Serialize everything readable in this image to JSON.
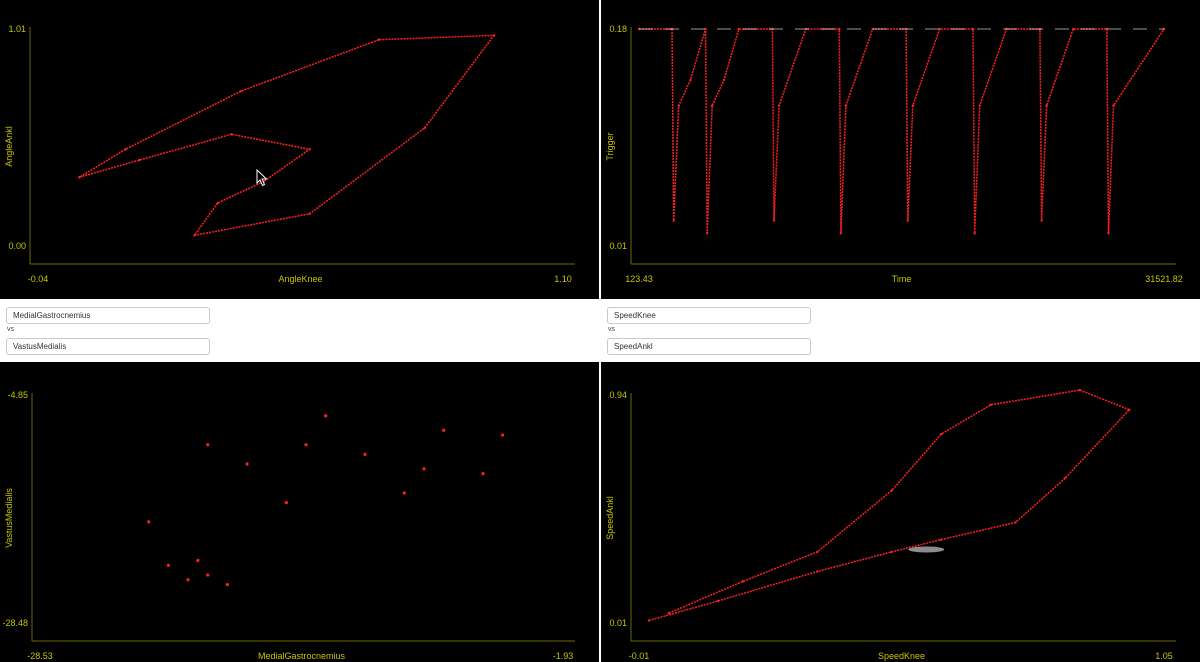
{
  "colors": {
    "background": "#000000",
    "axis": "#c8c400",
    "data": "#ff2020",
    "highlight": "#ffffff"
  },
  "controls": {
    "left": {
      "x_field": "MedialGastrocnemius",
      "vs_label": "vs",
      "y_field": "VastusMedialis"
    },
    "right": {
      "x_field": "SpeedKnee",
      "vs_label": "vs",
      "y_field": "SpeedAnkl"
    }
  },
  "chart_data": [
    {
      "type": "line",
      "xlabel": "AngleKnee",
      "ylabel": "AngleAnkl",
      "xlim": [
        -0.04,
        1.1
      ],
      "ylim": [
        0.0,
        1.01
      ],
      "x_ticks": [
        "-0.04",
        "1.10"
      ],
      "y_ticks": [
        "0.00",
        "1.01"
      ],
      "series": [
        {
          "values": [
            [
              0.05,
              0.32
            ],
            [
              0.18,
              0.4
            ],
            [
              0.38,
              0.52
            ],
            [
              0.55,
              0.45
            ],
            [
              0.45,
              0.3
            ],
            [
              0.35,
              0.2
            ],
            [
              0.3,
              0.05
            ],
            [
              0.55,
              0.15
            ],
            [
              0.8,
              0.55
            ],
            [
              0.95,
              0.98
            ],
            [
              0.7,
              0.96
            ],
            [
              0.4,
              0.72
            ],
            [
              0.15,
              0.45
            ],
            [
              0.05,
              0.32
            ]
          ]
        }
      ]
    },
    {
      "type": "line",
      "xlabel": "Time",
      "ylabel": "Trigger",
      "xlim": [
        123.43,
        31521.82
      ],
      "ylim": [
        0.01,
        0.18
      ],
      "x_ticks": [
        "123.43",
        "31521.82"
      ],
      "y_ticks": [
        "0.01",
        "0.18"
      ],
      "series": [
        {
          "values": [
            [
              123.43,
              0.18
            ],
            [
              2100,
              0.18
            ],
            [
              2200,
              0.03
            ],
            [
              2500,
              0.12
            ],
            [
              3200,
              0.14
            ],
            [
              4100,
              0.18
            ],
            [
              4200,
              0.02
            ],
            [
              4500,
              0.12
            ],
            [
              5200,
              0.14
            ],
            [
              6100,
              0.18
            ],
            [
              8100,
              0.18
            ],
            [
              8200,
              0.03
            ],
            [
              8500,
              0.12
            ],
            [
              10100,
              0.18
            ],
            [
              12100,
              0.18
            ],
            [
              12200,
              0.02
            ],
            [
              12500,
              0.12
            ],
            [
              14100,
              0.18
            ],
            [
              16100,
              0.18
            ],
            [
              16200,
              0.03
            ],
            [
              16500,
              0.12
            ],
            [
              18100,
              0.18
            ],
            [
              20100,
              0.18
            ],
            [
              20200,
              0.02
            ],
            [
              20500,
              0.12
            ],
            [
              22100,
              0.18
            ],
            [
              24100,
              0.18
            ],
            [
              24200,
              0.03
            ],
            [
              24500,
              0.12
            ],
            [
              26100,
              0.18
            ],
            [
              28100,
              0.18
            ],
            [
              28200,
              0.02
            ],
            [
              28500,
              0.12
            ],
            [
              31521.82,
              0.18
            ]
          ]
        }
      ]
    },
    {
      "type": "scatter",
      "xlabel": "MedialGastrocnemius",
      "ylabel": "VastusMedialis",
      "xlim": [
        -28.53,
        -1.93
      ],
      "ylim": [
        -28.48,
        -4.85
      ],
      "x_ticks": [
        "-28.53",
        "-1.93"
      ],
      "y_ticks": [
        "-28.48",
        "-4.85"
      ],
      "series": [
        {
          "values": [
            [
              -21.0,
              -24.0
            ],
            [
              -20.0,
              -23.5
            ],
            [
              -22.0,
              -22.5
            ],
            [
              -19.0,
              -24.5
            ],
            [
              -20.5,
              -22.0
            ],
            [
              -18.0,
              -12.0
            ],
            [
              -15.0,
              -10.0
            ],
            [
              -12.0,
              -11.0
            ],
            [
              -9.0,
              -12.5
            ],
            [
              -6.0,
              -13.0
            ],
            [
              -20.0,
              -10.0
            ],
            [
              -23.0,
              -18.0
            ],
            [
              -16.0,
              -16.0
            ],
            [
              -10.0,
              -15.0
            ],
            [
              -5.0,
              -9.0
            ],
            [
              -14.0,
              -7.0
            ],
            [
              -8.0,
              -8.5
            ]
          ]
        }
      ]
    },
    {
      "type": "line",
      "xlabel": "SpeedKnee",
      "ylabel": "SpeedAnkl",
      "xlim": [
        -0.01,
        1.05
      ],
      "ylim": [
        0.01,
        0.94
      ],
      "x_ticks": [
        "-0.01",
        "1.05"
      ],
      "y_ticks": [
        "0.01",
        "0.94"
      ],
      "series": [
        {
          "values": [
            [
              0.01,
              0.02
            ],
            [
              0.15,
              0.1
            ],
            [
              0.35,
              0.22
            ],
            [
              0.5,
              0.3
            ],
            [
              0.6,
              0.35
            ],
            [
              0.75,
              0.42
            ],
            [
              0.85,
              0.6
            ],
            [
              0.98,
              0.88
            ],
            [
              0.88,
              0.96
            ],
            [
              0.7,
              0.9
            ],
            [
              0.6,
              0.78
            ],
            [
              0.5,
              0.55
            ],
            [
              0.35,
              0.3
            ],
            [
              0.2,
              0.18
            ],
            [
              0.05,
              0.05
            ]
          ]
        }
      ]
    }
  ]
}
